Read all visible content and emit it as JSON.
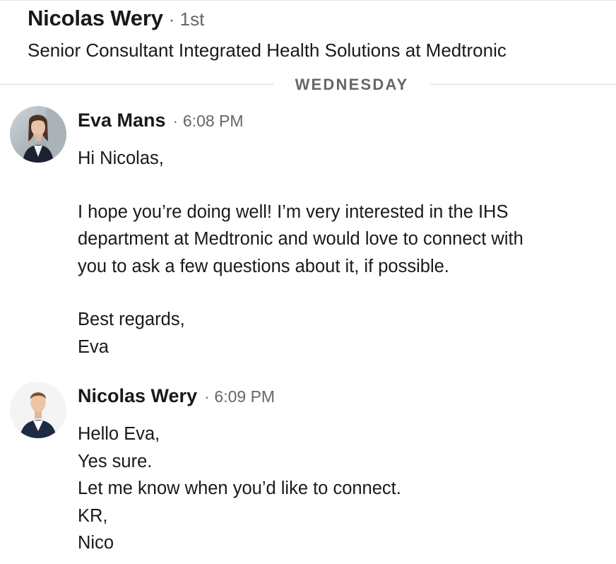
{
  "header": {
    "name": "Nicolas Wery",
    "degree": "· 1st",
    "headline": "Senior Consultant Integrated Health Solutions at Medtronic"
  },
  "day_divider": "WEDNESDAY",
  "messages": [
    {
      "sender": "Eva Mans",
      "dot": "·",
      "time": "6:08 PM",
      "avatar_icon": "profile-photo-woman",
      "paragraphs": [
        [
          "Hi Nicolas,"
        ],
        [
          "I hope you’re doing well! I’m very interested in the IHS",
          "department at Medtronic and would love to connect with",
          "you to ask a few questions about it, if possible."
        ],
        [
          "Best regards,",
          "Eva"
        ]
      ]
    },
    {
      "sender": "Nicolas Wery",
      "dot": "·",
      "time": "6:09 PM",
      "avatar_icon": "profile-photo-man",
      "paragraphs": [
        [
          "Hello Eva,",
          "Yes sure.",
          "Let me know when you’d like to connect.",
          "KR,",
          "Nico"
        ]
      ]
    }
  ],
  "colors": {
    "text_primary": "#191919",
    "text_secondary": "#666666",
    "divider": "#e0e0e0",
    "background": "#ffffff"
  }
}
